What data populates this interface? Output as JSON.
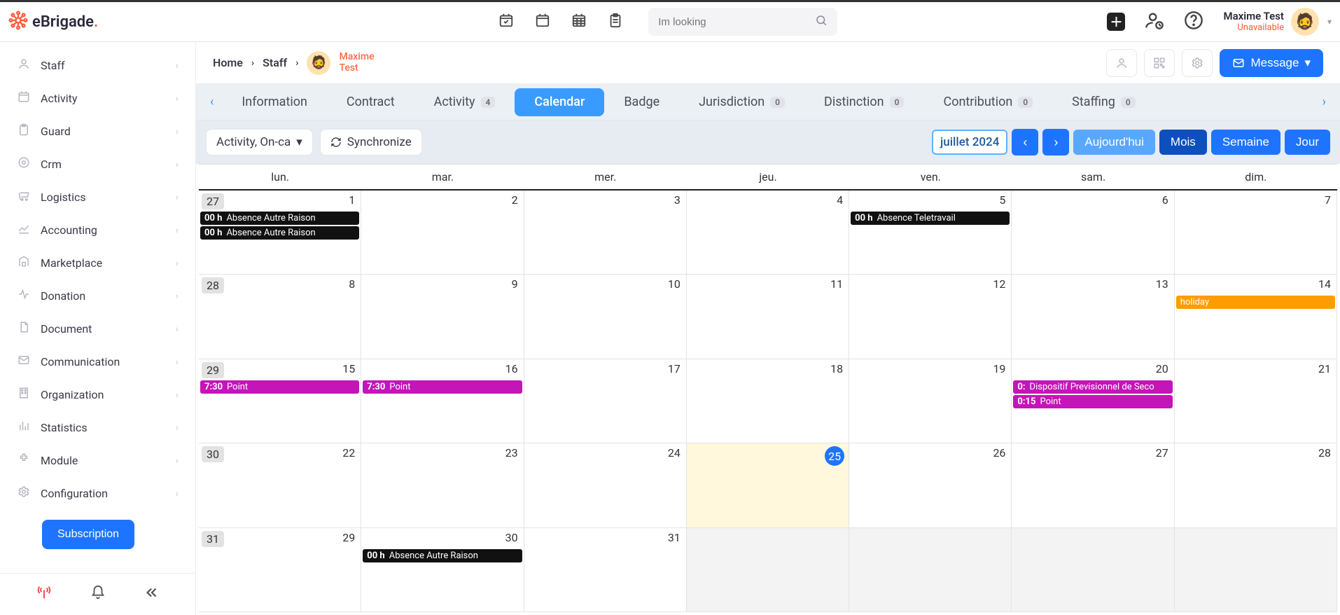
{
  "brand": {
    "name_e": "e",
    "name_main": "Brigade",
    "dot": "."
  },
  "search": {
    "placeholder": "Im looking"
  },
  "user": {
    "name": "Maxime Test",
    "status": "Unavailable"
  },
  "sidebar": {
    "items": [
      {
        "label": "Staff"
      },
      {
        "label": "Activity"
      },
      {
        "label": "Guard"
      },
      {
        "label": "Crm"
      },
      {
        "label": "Logistics"
      },
      {
        "label": "Accounting"
      },
      {
        "label": "Marketplace"
      },
      {
        "label": "Donation"
      },
      {
        "label": "Document"
      },
      {
        "label": "Communication"
      },
      {
        "label": "Organization"
      },
      {
        "label": "Statistics"
      },
      {
        "label": "Module"
      },
      {
        "label": "Configuration"
      }
    ],
    "subscription": "Subscription"
  },
  "breadcrumb": {
    "home": "Home",
    "staff": "Staff",
    "person_first": "Maxime",
    "person_last": "Test"
  },
  "actions": {
    "message": "Message"
  },
  "tabs": {
    "information": "Information",
    "contract": "Contract",
    "activity": "Activity",
    "activity_badge": "4",
    "calendar": "Calendar",
    "badge": "Badge",
    "jurisdiction": "Jurisdiction",
    "jurisdiction_badge": "0",
    "distinction": "Distinction",
    "distinction_badge": "0",
    "contribution": "Contribution",
    "contribution_badge": "0",
    "staffing": "Staffing",
    "staffing_badge": "0"
  },
  "toolbar": {
    "filter": "Activity, On-ca",
    "sync": "Synchronize",
    "period": "juillet 2024",
    "today": "Aujourd'hui",
    "month": "Mois",
    "week": "Semaine",
    "day": "Jour"
  },
  "calendar": {
    "day_headers": [
      "lun.",
      "mar.",
      "mer.",
      "jeu.",
      "ven.",
      "sam.",
      "dim."
    ],
    "weeks": [
      [
        {
          "num_out": "27",
          "num": "1",
          "events": [
            {
              "time": "00 h",
              "label": "Absence Autre Raison",
              "cls": "black"
            },
            {
              "time": "00 h",
              "label": "Absence Autre Raison",
              "cls": "black"
            }
          ]
        },
        {
          "num": "2"
        },
        {
          "num": "3"
        },
        {
          "num": "4"
        },
        {
          "num": "5",
          "events": [
            {
              "time": "00 h",
              "label": "Absence Teletravail",
              "cls": "black"
            }
          ]
        },
        {
          "num": "6"
        },
        {
          "num": "7"
        }
      ],
      [
        {
          "num_out": "28",
          "num": "8"
        },
        {
          "num": "9"
        },
        {
          "num": "10"
        },
        {
          "num": "11"
        },
        {
          "num": "12"
        },
        {
          "num": "13"
        },
        {
          "num": "14",
          "events": [
            {
              "time": "",
              "label": "holiday",
              "cls": "orange"
            }
          ]
        }
      ],
      [
        {
          "num_out": "29",
          "num": "15",
          "events": [
            {
              "time": "7:30",
              "label": "Point",
              "cls": "magenta"
            }
          ]
        },
        {
          "num": "16",
          "events": [
            {
              "time": "7:30",
              "label": "Point",
              "cls": "magenta"
            }
          ]
        },
        {
          "num": "17"
        },
        {
          "num": "18"
        },
        {
          "num": "19"
        },
        {
          "num": "20",
          "events": [
            {
              "time": "0:",
              "label": "Dispositif Previsionnel de Seco",
              "cls": "magenta"
            },
            {
              "time": "0:15",
              "label": "Point",
              "cls": "magenta"
            }
          ]
        },
        {
          "num": "21"
        }
      ],
      [
        {
          "num_out": "30",
          "num": "22"
        },
        {
          "num": "23"
        },
        {
          "num": "24"
        },
        {
          "num": "25",
          "today": true
        },
        {
          "num": "26"
        },
        {
          "num": "27"
        },
        {
          "num": "28"
        }
      ],
      [
        {
          "num_out": "31",
          "num": "29"
        },
        {
          "num": "30",
          "events": [
            {
              "time": "00 h",
              "label": "Absence Autre Raison",
              "cls": "black"
            }
          ]
        },
        {
          "num": "31"
        },
        {
          "out": true
        },
        {
          "out": true
        },
        {
          "out": true
        },
        {
          "out": true
        }
      ]
    ]
  }
}
